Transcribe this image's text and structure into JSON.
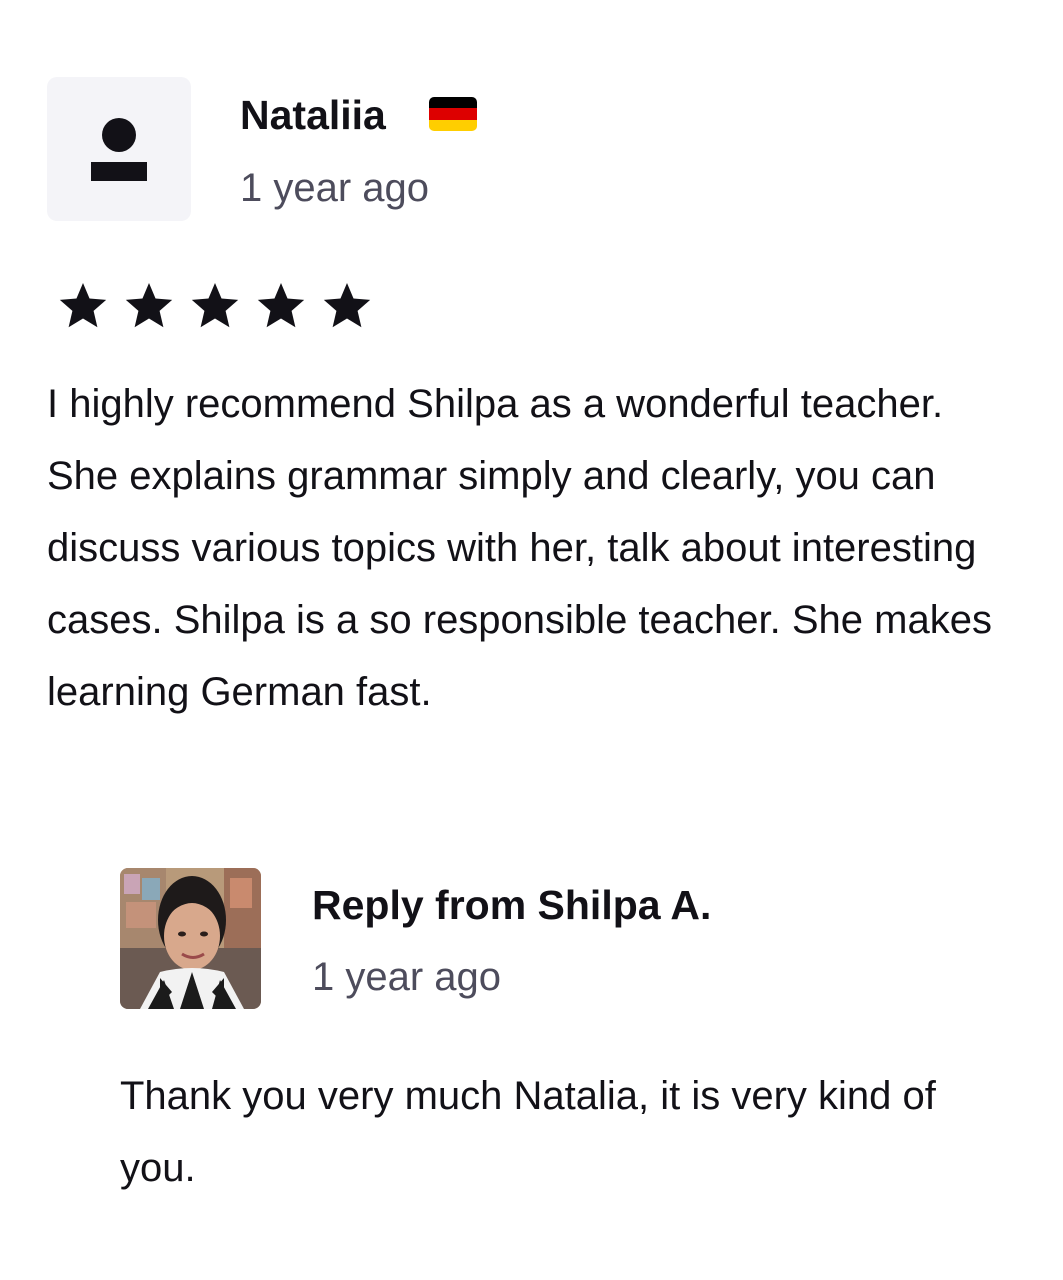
{
  "review": {
    "author_name": "Nataliia",
    "author_flag_icon": "germany-flag-icon",
    "flag_colors": [
      "#000000",
      "#dd0000",
      "#ffce00"
    ],
    "time": "1 year ago",
    "rating": 5,
    "rating_max": 5,
    "text": "I highly recommend Shilpa as a wonderful teacher. She explains grammar simply and clearly, you can discuss various topics with her, talk about interesting cases.  Shilpa is a so responsible teacher.  She makes learning German fast."
  },
  "reply": {
    "title": "Reply from Shilpa A.",
    "time": "1 year ago",
    "text": "Thank you very much Natalia, it is very kind of you."
  },
  "colors": {
    "text_primary": "#121117",
    "text_secondary": "#4d4c5c",
    "avatar_placeholder_bg": "#f4f4f8"
  }
}
